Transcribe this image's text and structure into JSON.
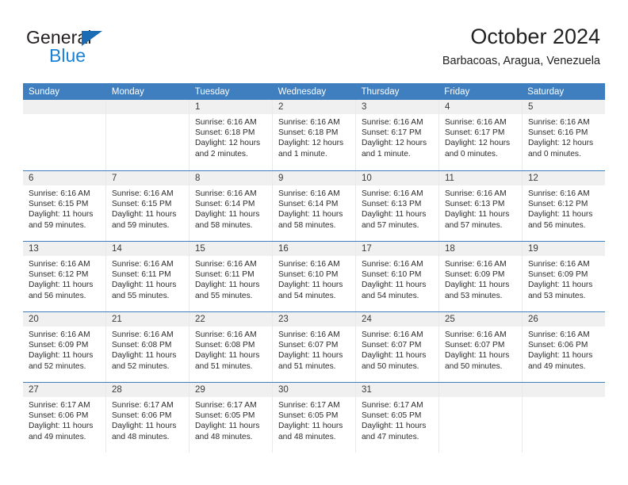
{
  "brand": {
    "name_top": "General",
    "name_bottom": "Blue",
    "color_dark": "#231f20",
    "color_blue": "#1a81d6",
    "triangle_color": "#1a6cb5"
  },
  "header": {
    "title": "October 2024",
    "subtitle": "Barbacoas, Aragua, Venezuela"
  },
  "theme": {
    "header_blue": "#3f7fbf",
    "day_band_gray": "#f0f0f0",
    "cell_border": "#e9e9e9"
  },
  "weekdays": [
    "Sunday",
    "Monday",
    "Tuesday",
    "Wednesday",
    "Thursday",
    "Friday",
    "Saturday"
  ],
  "weeks": [
    [
      {
        "day": "",
        "sunrise": "",
        "sunset": "",
        "daylight": "",
        "empty": true
      },
      {
        "day": "",
        "sunrise": "",
        "sunset": "",
        "daylight": "",
        "empty": true
      },
      {
        "day": "1",
        "sunrise": "Sunrise: 6:16 AM",
        "sunset": "Sunset: 6:18 PM",
        "daylight": "Daylight: 12 hours and 2 minutes."
      },
      {
        "day": "2",
        "sunrise": "Sunrise: 6:16 AM",
        "sunset": "Sunset: 6:18 PM",
        "daylight": "Daylight: 12 hours and 1 minute."
      },
      {
        "day": "3",
        "sunrise": "Sunrise: 6:16 AM",
        "sunset": "Sunset: 6:17 PM",
        "daylight": "Daylight: 12 hours and 1 minute."
      },
      {
        "day": "4",
        "sunrise": "Sunrise: 6:16 AM",
        "sunset": "Sunset: 6:17 PM",
        "daylight": "Daylight: 12 hours and 0 minutes."
      },
      {
        "day": "5",
        "sunrise": "Sunrise: 6:16 AM",
        "sunset": "Sunset: 6:16 PM",
        "daylight": "Daylight: 12 hours and 0 minutes."
      }
    ],
    [
      {
        "day": "6",
        "sunrise": "Sunrise: 6:16 AM",
        "sunset": "Sunset: 6:15 PM",
        "daylight": "Daylight: 11 hours and 59 minutes."
      },
      {
        "day": "7",
        "sunrise": "Sunrise: 6:16 AM",
        "sunset": "Sunset: 6:15 PM",
        "daylight": "Daylight: 11 hours and 59 minutes."
      },
      {
        "day": "8",
        "sunrise": "Sunrise: 6:16 AM",
        "sunset": "Sunset: 6:14 PM",
        "daylight": "Daylight: 11 hours and 58 minutes."
      },
      {
        "day": "9",
        "sunrise": "Sunrise: 6:16 AM",
        "sunset": "Sunset: 6:14 PM",
        "daylight": "Daylight: 11 hours and 58 minutes."
      },
      {
        "day": "10",
        "sunrise": "Sunrise: 6:16 AM",
        "sunset": "Sunset: 6:13 PM",
        "daylight": "Daylight: 11 hours and 57 minutes."
      },
      {
        "day": "11",
        "sunrise": "Sunrise: 6:16 AM",
        "sunset": "Sunset: 6:13 PM",
        "daylight": "Daylight: 11 hours and 57 minutes."
      },
      {
        "day": "12",
        "sunrise": "Sunrise: 6:16 AM",
        "sunset": "Sunset: 6:12 PM",
        "daylight": "Daylight: 11 hours and 56 minutes."
      }
    ],
    [
      {
        "day": "13",
        "sunrise": "Sunrise: 6:16 AM",
        "sunset": "Sunset: 6:12 PM",
        "daylight": "Daylight: 11 hours and 56 minutes."
      },
      {
        "day": "14",
        "sunrise": "Sunrise: 6:16 AM",
        "sunset": "Sunset: 6:11 PM",
        "daylight": "Daylight: 11 hours and 55 minutes."
      },
      {
        "day": "15",
        "sunrise": "Sunrise: 6:16 AM",
        "sunset": "Sunset: 6:11 PM",
        "daylight": "Daylight: 11 hours and 55 minutes."
      },
      {
        "day": "16",
        "sunrise": "Sunrise: 6:16 AM",
        "sunset": "Sunset: 6:10 PM",
        "daylight": "Daylight: 11 hours and 54 minutes."
      },
      {
        "day": "17",
        "sunrise": "Sunrise: 6:16 AM",
        "sunset": "Sunset: 6:10 PM",
        "daylight": "Daylight: 11 hours and 54 minutes."
      },
      {
        "day": "18",
        "sunrise": "Sunrise: 6:16 AM",
        "sunset": "Sunset: 6:09 PM",
        "daylight": "Daylight: 11 hours and 53 minutes."
      },
      {
        "day": "19",
        "sunrise": "Sunrise: 6:16 AM",
        "sunset": "Sunset: 6:09 PM",
        "daylight": "Daylight: 11 hours and 53 minutes."
      }
    ],
    [
      {
        "day": "20",
        "sunrise": "Sunrise: 6:16 AM",
        "sunset": "Sunset: 6:09 PM",
        "daylight": "Daylight: 11 hours and 52 minutes."
      },
      {
        "day": "21",
        "sunrise": "Sunrise: 6:16 AM",
        "sunset": "Sunset: 6:08 PM",
        "daylight": "Daylight: 11 hours and 52 minutes."
      },
      {
        "day": "22",
        "sunrise": "Sunrise: 6:16 AM",
        "sunset": "Sunset: 6:08 PM",
        "daylight": "Daylight: 11 hours and 51 minutes."
      },
      {
        "day": "23",
        "sunrise": "Sunrise: 6:16 AM",
        "sunset": "Sunset: 6:07 PM",
        "daylight": "Daylight: 11 hours and 51 minutes."
      },
      {
        "day": "24",
        "sunrise": "Sunrise: 6:16 AM",
        "sunset": "Sunset: 6:07 PM",
        "daylight": "Daylight: 11 hours and 50 minutes."
      },
      {
        "day": "25",
        "sunrise": "Sunrise: 6:16 AM",
        "sunset": "Sunset: 6:07 PM",
        "daylight": "Daylight: 11 hours and 50 minutes."
      },
      {
        "day": "26",
        "sunrise": "Sunrise: 6:16 AM",
        "sunset": "Sunset: 6:06 PM",
        "daylight": "Daylight: 11 hours and 49 minutes."
      }
    ],
    [
      {
        "day": "27",
        "sunrise": "Sunrise: 6:17 AM",
        "sunset": "Sunset: 6:06 PM",
        "daylight": "Daylight: 11 hours and 49 minutes."
      },
      {
        "day": "28",
        "sunrise": "Sunrise: 6:17 AM",
        "sunset": "Sunset: 6:06 PM",
        "daylight": "Daylight: 11 hours and 48 minutes."
      },
      {
        "day": "29",
        "sunrise": "Sunrise: 6:17 AM",
        "sunset": "Sunset: 6:05 PM",
        "daylight": "Daylight: 11 hours and 48 minutes."
      },
      {
        "day": "30",
        "sunrise": "Sunrise: 6:17 AM",
        "sunset": "Sunset: 6:05 PM",
        "daylight": "Daylight: 11 hours and 48 minutes."
      },
      {
        "day": "31",
        "sunrise": "Sunrise: 6:17 AM",
        "sunset": "Sunset: 6:05 PM",
        "daylight": "Daylight: 11 hours and 47 minutes."
      },
      {
        "day": "",
        "sunrise": "",
        "sunset": "",
        "daylight": "",
        "empty": true
      },
      {
        "day": "",
        "sunrise": "",
        "sunset": "",
        "daylight": "",
        "empty": true
      }
    ]
  ]
}
